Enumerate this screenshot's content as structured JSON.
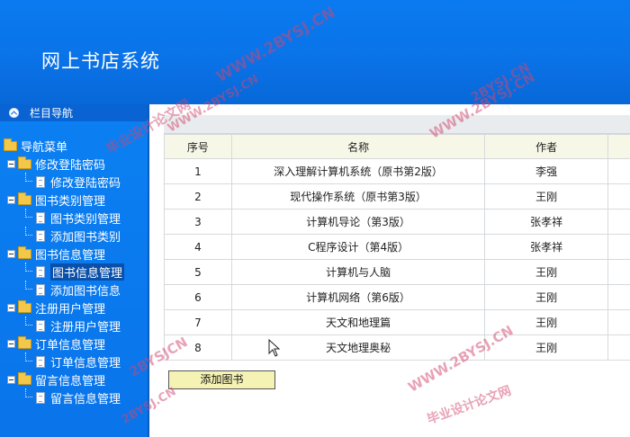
{
  "app": {
    "title": "网上书店系统"
  },
  "sidebar": {
    "header": "栏目导航",
    "root": "导航菜单",
    "groups": [
      {
        "label": "修改登陆密码",
        "items": [
          {
            "label": "修改登陆密码"
          }
        ]
      },
      {
        "label": "图书类别管理",
        "items": [
          {
            "label": "图书类别管理"
          },
          {
            "label": "添加图书类别"
          }
        ]
      },
      {
        "label": "图书信息管理",
        "items": [
          {
            "label": "图书信息管理",
            "selected": true
          },
          {
            "label": "添加图书信息"
          }
        ]
      },
      {
        "label": "注册用户管理",
        "items": [
          {
            "label": "注册用户管理"
          }
        ]
      },
      {
        "label": "订单信息管理",
        "items": [
          {
            "label": "订单信息管理"
          }
        ]
      },
      {
        "label": "留言信息管理",
        "items": [
          {
            "label": "留言信息管理"
          }
        ]
      }
    ]
  },
  "table": {
    "columns": [
      "序号",
      "名称",
      "作者",
      ""
    ],
    "rows": [
      [
        "1",
        "深入理解计算机系统（原书第2版）",
        "李强",
        ""
      ],
      [
        "2",
        "现代操作系统（原书第3版）",
        "王刚",
        ""
      ],
      [
        "3",
        "计算机导论（第3版）",
        "张孝祥",
        ""
      ],
      [
        "4",
        "C程序设计（第4版）",
        "张孝祥",
        ""
      ],
      [
        "5",
        "计算机与人脑",
        "王刚",
        ""
      ],
      [
        "6",
        "计算机网络（第6版）",
        "王刚",
        ""
      ],
      [
        "7",
        "天文和地理篇",
        "王刚",
        ""
      ],
      [
        "8",
        "天文地理奥秘",
        "王刚",
        ""
      ]
    ]
  },
  "actions": {
    "add_book": "添加图书"
  },
  "watermarks": {
    "domain": "WWW.2BYSJ.CN",
    "domain_short": "2BYSJ.CN",
    "domain_mixed": "2BYSJCN",
    "domain_dots": "WWW.2BYSJ.CN",
    "brand": "毕业设计论文网",
    "brand_url": "WWW.2BYSJ.CN"
  }
}
